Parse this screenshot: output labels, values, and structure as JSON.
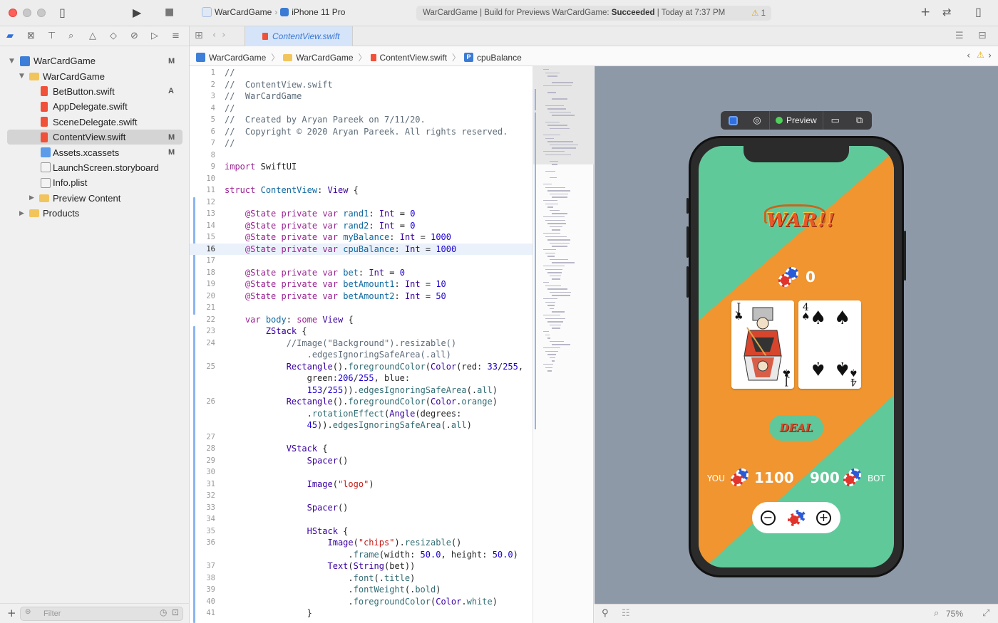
{
  "titlebar": {
    "scheme_target": "WarCardGame",
    "device": "iPhone 11 Pro",
    "status_prefix": "WarCardGame | Build for Previews WarCardGame: ",
    "status_result": "Succeeded",
    "status_time": " | Today at 7:37 PM",
    "warning_count": "1"
  },
  "navigator": {
    "filter_placeholder": "Filter",
    "items": [
      {
        "label": "WarCardGame",
        "status": "M"
      },
      {
        "label": "WarCardGame",
        "status": ""
      },
      {
        "label": "BetButton.swift",
        "status": "A"
      },
      {
        "label": "AppDelegate.swift",
        "status": ""
      },
      {
        "label": "SceneDelegate.swift",
        "status": ""
      },
      {
        "label": "ContentView.swift",
        "status": "M"
      },
      {
        "label": "Assets.xcassets",
        "status": "M"
      },
      {
        "label": "LaunchScreen.storyboard",
        "status": ""
      },
      {
        "label": "Info.plist",
        "status": ""
      },
      {
        "label": "Preview Content",
        "status": ""
      },
      {
        "label": "Products",
        "status": ""
      }
    ]
  },
  "editor": {
    "tab_label": "ContentView.swift",
    "breadcrumbs": [
      "WarCardGame",
      "WarCardGame",
      "ContentView.swift",
      "cpuBalance"
    ],
    "current_line": 16
  },
  "preview": {
    "toolbar_label": "Preview",
    "bet": "0",
    "card_left": {
      "rank": "J",
      "suit": "♣"
    },
    "card_right": {
      "rank": "4",
      "suit": "♠"
    },
    "deal_label": "DEAL",
    "you_label": "YOU",
    "bot_label": "BOT",
    "my_balance": "1100",
    "cpu_balance": "900",
    "logo_text": "WAR!!",
    "background_green": "#60c99a",
    "background_orange": "#f0952f"
  },
  "canvas_bottom": {
    "zoom": "75%"
  }
}
